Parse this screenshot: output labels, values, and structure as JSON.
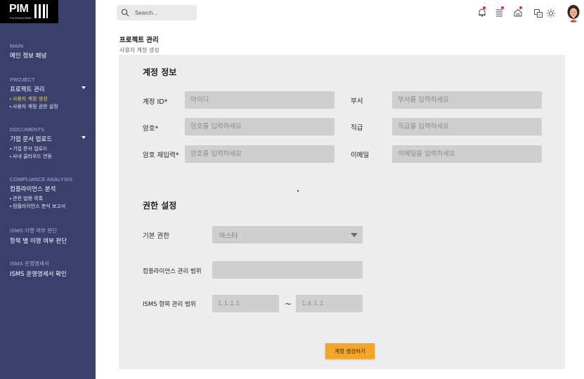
{
  "app": {
    "logo_text": "PIM",
    "logo_sub": "For Perfect ISMS"
  },
  "sidebar": {
    "sections": [
      {
        "category": "MAIN",
        "title": "메인 정보 패널",
        "items": []
      },
      {
        "category": "PROJECT",
        "title": "프로젝트 관리",
        "expandable": true,
        "items": [
          {
            "label": "사용자 계정 생성",
            "active": true
          },
          {
            "label": "사용자 계정 권한 설정",
            "active": false
          }
        ]
      },
      {
        "category": "DOCUMENTS",
        "title": "기업 문서 업로드",
        "expandable": true,
        "items": [
          {
            "label": "기업 문서 업로드",
            "active": false
          },
          {
            "label": "사내 클라우드 연동",
            "active": false
          }
        ]
      },
      {
        "category": "COMPLIANCE ANALYSIS",
        "title": "컴플라이언스 분석",
        "items": [
          {
            "label": "관련 법령 목록",
            "active": false
          },
          {
            "label": "컴플라이언스 분석 보고서",
            "active": false
          }
        ]
      },
      {
        "category": "ISMS 이행 여부 판단",
        "title": "항목 별 이행 여부 판단",
        "items": []
      },
      {
        "category": "ISMS 운영명세서",
        "title": "ISMS 운영명세서 확인",
        "items": []
      }
    ]
  },
  "search": {
    "placeholder": "Search..."
  },
  "toolbar": {
    "icons": [
      "bell-icon",
      "list-icon",
      "home-icon",
      "translate-icon",
      "sun-icon"
    ],
    "accent_dot": "#e0245e"
  },
  "page": {
    "title": "프로젝트 관리",
    "subtitle": "사용자 계정 생성"
  },
  "account_info": {
    "section_title": "계정 정보",
    "account_id_label": "계정 ID*",
    "account_id_placeholder": "아이디",
    "password_label": "암호*",
    "password_placeholder": "암호를 입력하세요",
    "password_confirm_label": "암호 재입력*",
    "password_confirm_placeholder": "암호를 입력하세요",
    "department_label": "부서",
    "department_placeholder": "부서를 입력하세요",
    "position_label": "직급",
    "position_placeholder": "직급을 입력하세요",
    "email_label": "이메일",
    "email_placeholder": "이메일을 입력하세요"
  },
  "permissions": {
    "section_title": "권한 설정",
    "default_role_label": "기본 권한",
    "default_role_value": "마스터",
    "compliance_scope_label": "컴플라이언스 관리 범위",
    "compliance_scope_value": "",
    "isms_scope_label": "ISMS 항목 관리 범위",
    "isms_from_placeholder": "1.1.1.1",
    "isms_to_placeholder": "1.4.1.1",
    "range_separator": "~"
  },
  "submit": {
    "label": "계정 생성하기",
    "color": "#f5a623"
  }
}
